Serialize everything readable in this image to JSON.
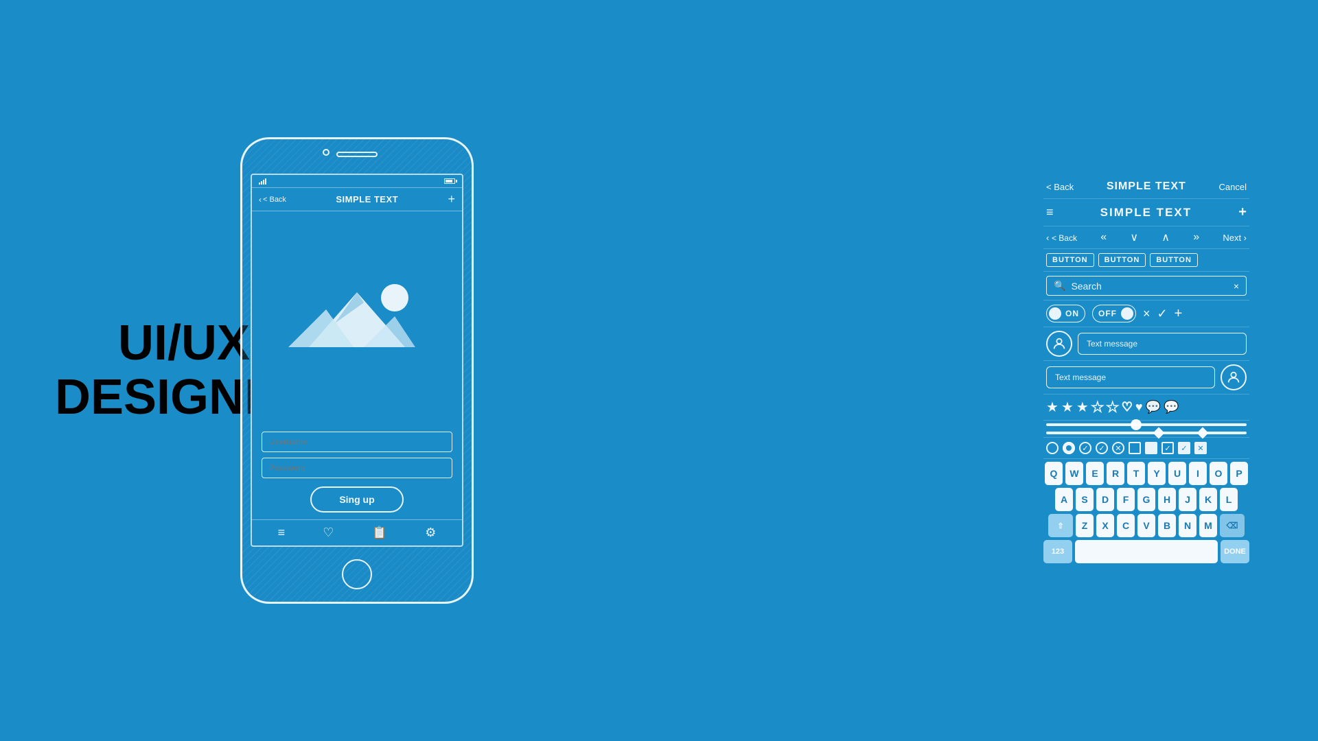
{
  "left_panel": {
    "title_line1": "UI/UX",
    "title_line2": "DESIGNER"
  },
  "phone": {
    "back_label": "< Back",
    "page_title": "SIMPLE TEXT",
    "plus_label": "+",
    "username_placeholder": "Username",
    "password_placeholder": "Password",
    "signup_button": "Sing up",
    "nav_icons": [
      "≡",
      "♡",
      "📋",
      "⚙"
    ]
  },
  "right_panel": {
    "nav_bar": {
      "back_label": "< Back",
      "title": "SIMPLE TEXT",
      "cancel_label": "Cancel"
    },
    "title_row": {
      "menu_icon": "≡",
      "title": "SIMPLE TEXT",
      "plus_label": "+"
    },
    "arrows_row": {
      "back": "< Back",
      "left_double": "«",
      "down": "∨",
      "up": "∧",
      "right_double": "»",
      "next": "Next >"
    },
    "buttons": [
      "BUTTON",
      "BUTTON",
      "BUTTON"
    ],
    "search_placeholder": "Search",
    "search_clear": "×",
    "toggle_on_label": "ON",
    "toggle_off_label": "OFF",
    "toggle_x": "×",
    "toggle_check": "✓",
    "toggle_plus": "+",
    "msg_left_placeholder": "Text message",
    "msg_right_placeholder": "Text message",
    "stars_filled": 3,
    "stars_total": 5,
    "keyboard_rows": [
      [
        "Q",
        "W",
        "E",
        "R",
        "T",
        "Y",
        "U",
        "I",
        "O",
        "P"
      ],
      [
        "A",
        "S",
        "D",
        "F",
        "G",
        "H",
        "J",
        "K",
        "L"
      ],
      [
        "⇧",
        "Z",
        "X",
        "C",
        "V",
        "B",
        "N",
        "M",
        "⌫"
      ],
      [
        "123",
        " ",
        "DONE"
      ]
    ]
  }
}
